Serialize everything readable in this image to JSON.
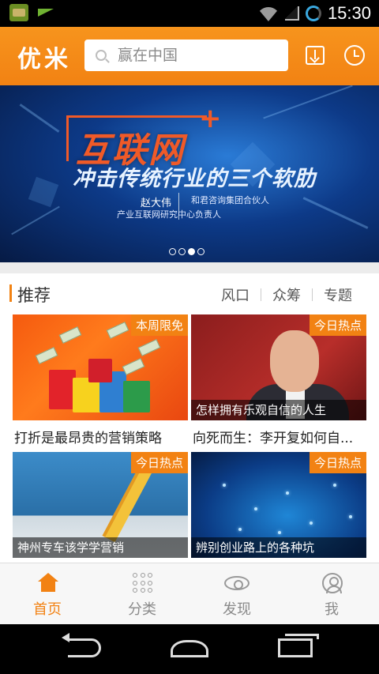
{
  "status_bar": {
    "time": "15:30"
  },
  "header": {
    "logo": "优米",
    "search_placeholder": "赢在中国"
  },
  "banner": {
    "title": "互联网",
    "plus": "+",
    "subtitle": "冲击传统行业的三个软肋",
    "name": "赵大伟",
    "desc_line1": "和君咨询集团合伙人",
    "desc_line2": "产业互联网研究中心负责人",
    "slide_count": 4,
    "active_slide": 3
  },
  "recommend": {
    "title": "推荐",
    "links": [
      "风口",
      "众筹",
      "专题"
    ],
    "cards": [
      {
        "badge": "本周限免",
        "caption": "",
        "title": "打折是最昂贵的营销策略"
      },
      {
        "badge": "今日热点",
        "caption": "怎样拥有乐观自信的人生",
        "title": "向死而生：李开复如何自..."
      },
      {
        "badge": "今日热点",
        "caption": "神州专车该学学营销",
        "title": ""
      },
      {
        "badge": "今日热点",
        "caption": "辨别创业路上的各种坑",
        "title": ""
      }
    ]
  },
  "tabs": [
    {
      "label": "首页",
      "icon": "home-icon",
      "active": true
    },
    {
      "label": "分类",
      "icon": "grid-icon",
      "active": false
    },
    {
      "label": "发现",
      "icon": "eye-icon",
      "active": false
    },
    {
      "label": "我",
      "icon": "user-icon",
      "active": false
    }
  ],
  "colors": {
    "accent": "#f28213",
    "inactive": "#8a8a8a"
  }
}
